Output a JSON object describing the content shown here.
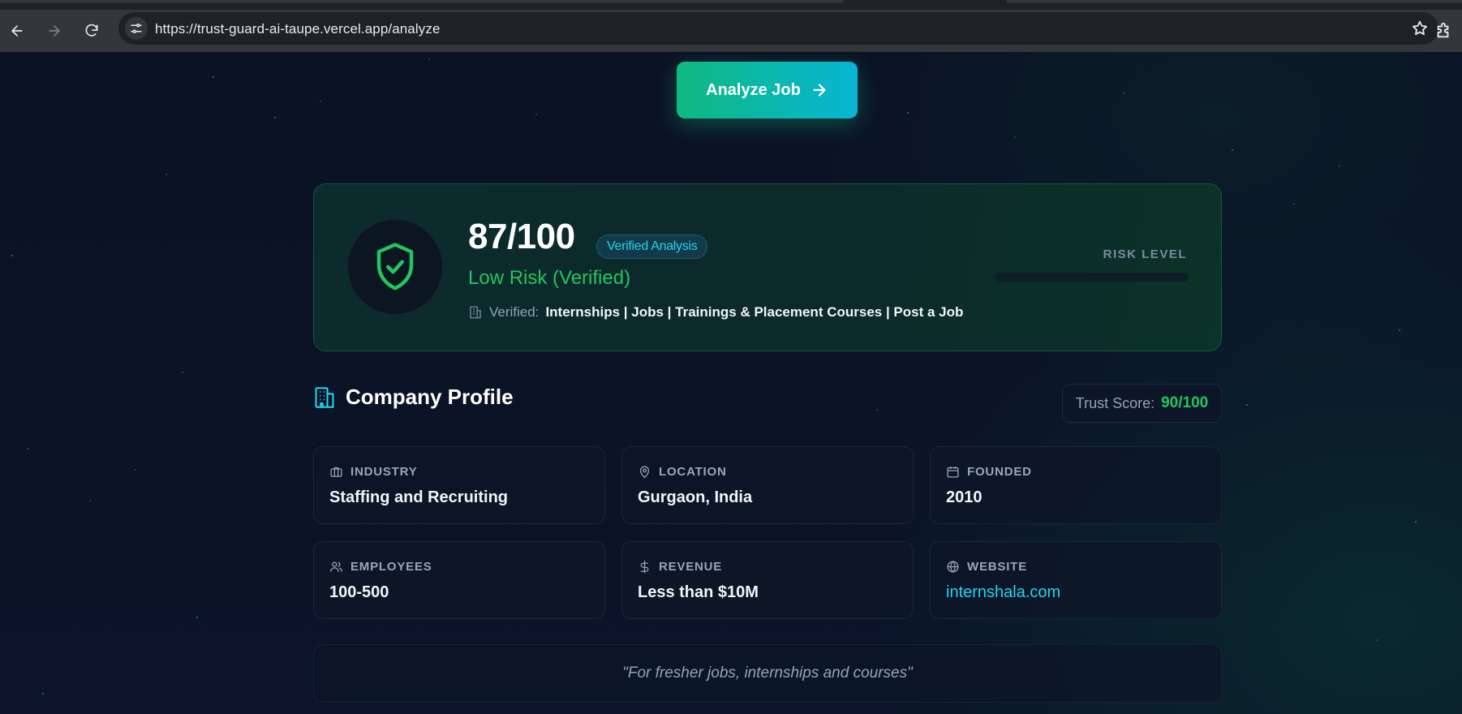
{
  "browser": {
    "url": "https://trust-guard-ai-taupe.vercel.app/analyze"
  },
  "analyze": {
    "button_label": "Analyze Job"
  },
  "result": {
    "score": "87/100",
    "badge": "Verified Analysis",
    "risk_label": "Low Risk (Verified)",
    "verified_label": "Verified:",
    "verified_value": "Internships | Jobs | Trainings & Placement Courses | Post a Job",
    "risk_level_heading": "RISK LEVEL",
    "risk_level_fill_percent": 0
  },
  "company_profile": {
    "title": "Company Profile",
    "trust_score_label": "Trust Score:",
    "trust_score_value": "90/100",
    "cards": [
      {
        "label": "INDUSTRY",
        "value": "Staffing and Recruiting",
        "icon": "briefcase-icon"
      },
      {
        "label": "LOCATION",
        "value": "Gurgaon, India",
        "icon": "map-pin-icon"
      },
      {
        "label": "FOUNDED",
        "value": "2010",
        "icon": "calendar-icon"
      },
      {
        "label": "EMPLOYEES",
        "value": "100-500",
        "icon": "users-icon"
      },
      {
        "label": "REVENUE",
        "value": "Less than $10M",
        "icon": "dollar-icon"
      },
      {
        "label": "WEBSITE",
        "value": "internshala.com",
        "icon": "globe-icon"
      }
    ],
    "tagline": "\"For fresher jobs, internships and courses\""
  },
  "colors": {
    "accent_green": "#22c55e",
    "accent_cyan": "#22d3ee",
    "page_bg": "#0b1224"
  }
}
